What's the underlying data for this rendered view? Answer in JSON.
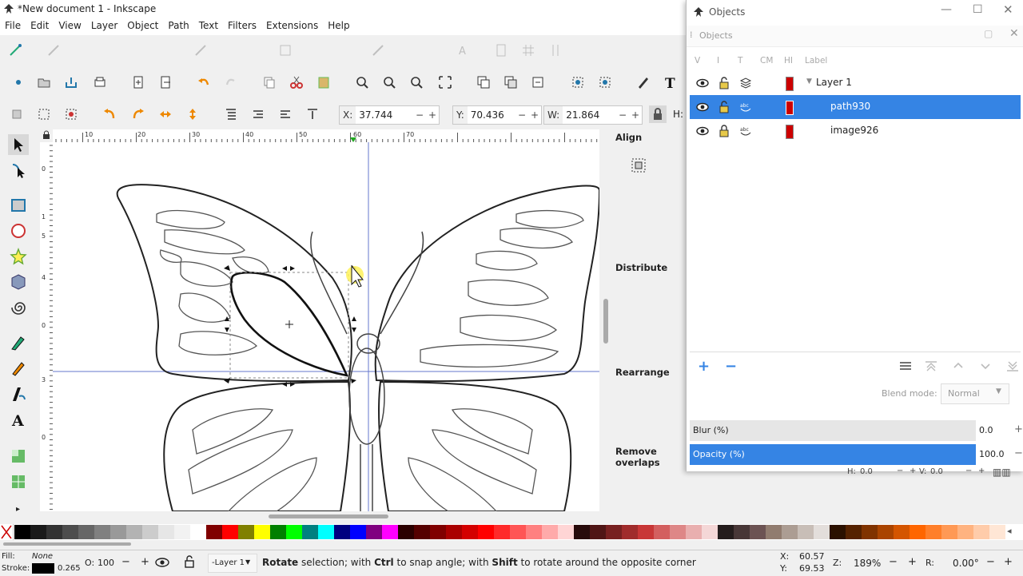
{
  "window": {
    "title": "*New document 1 - Inkscape"
  },
  "menu": [
    "File",
    "Edit",
    "View",
    "Layer",
    "Object",
    "Path",
    "Text",
    "Filters",
    "Extensions",
    "Help"
  ],
  "selector": {
    "x": {
      "label": "X:",
      "value": "37.744"
    },
    "y": {
      "label": "Y:",
      "value": "70.436"
    },
    "w": {
      "label": "W:",
      "value": "21.864"
    },
    "h_label": "H:"
  },
  "ruler_top_ticks": [
    "10",
    "20",
    "30",
    "40",
    "50",
    "60",
    "70"
  ],
  "ruler_left_ticks": [
    "0",
    "1",
    "5",
    "4",
    "0",
    "3",
    "0"
  ],
  "dock": {
    "align": "Align",
    "distribute": "Distribute",
    "rearrange": "Rearrange",
    "remove_overlaps": "Remove overlaps"
  },
  "objects_window": {
    "title": "Objects",
    "tab": "Objects",
    "columns": [
      "V",
      "I",
      "T",
      "CM",
      "HI",
      "Label"
    ],
    "rows": [
      {
        "label": "Layer 1",
        "selected": false
      },
      {
        "label": "path930",
        "selected": true
      },
      {
        "label": "image926",
        "selected": false
      }
    ],
    "blend_mode_label": "Blend mode:",
    "blend_mode_value": "Normal",
    "blur_label": "Blur (%)",
    "blur_value": "0.0",
    "opacity_label": "Opacity (%)",
    "opacity_value": "100.0",
    "h_label": "H:",
    "h_value": "0.0",
    "v_label": "V:",
    "v_value": "0.0"
  },
  "palette_colors": [
    "#000000",
    "#1a1a1a",
    "#333333",
    "#4d4d4d",
    "#666666",
    "#808080",
    "#999999",
    "#b3b3b3",
    "#cccccc",
    "#e6e6e6",
    "#f2f2f2",
    "#ffffff",
    "#800000",
    "#ff0000",
    "#808000",
    "#ffff00",
    "#008000",
    "#00ff00",
    "#008080",
    "#00ffff",
    "#000080",
    "#0000ff",
    "#800080",
    "#ff00ff",
    "#2b0000",
    "#550000",
    "#800000",
    "#aa0000",
    "#d40000",
    "#ff0000",
    "#ff2a2a",
    "#ff5555",
    "#ff8080",
    "#ffaaaa",
    "#ffd5d5",
    "#280b0b",
    "#501616",
    "#782121",
    "#a02c2c",
    "#c83737",
    "#d35f5f",
    "#de8787",
    "#e9afaf",
    "#f4d7d7",
    "#241c1c",
    "#483737",
    "#6c5353",
    "#917c6f",
    "#ac9d93",
    "#c8beb7",
    "#e3dedb",
    "#2b1100",
    "#552200",
    "#803300",
    "#aa4400",
    "#d45500",
    "#ff6600",
    "#ff7f2a",
    "#ff9955",
    "#ffb380",
    "#ffccaa",
    "#ffe6d5"
  ],
  "status": {
    "fill_label": "Fill:",
    "fill_value": "None",
    "stroke_label": "Stroke:",
    "stroke_width": "0.265",
    "opacity_label": "O:",
    "opacity_value": "100",
    "layer": "-Layer 1",
    "message_bold1": "Rotate",
    "message_1": " selection; with ",
    "message_bold2": "Ctrl",
    "message_2": " to snap angle; with ",
    "message_bold3": "Shift",
    "message_3": " to rotate around the opposite corner",
    "x_label": "X:",
    "x_value": "60.57",
    "y_label": "Y:",
    "y_value": "69.53",
    "zoom_label": "Z:",
    "zoom_value": "189%",
    "rot_label": "R:",
    "rot_value": "0.00°"
  }
}
